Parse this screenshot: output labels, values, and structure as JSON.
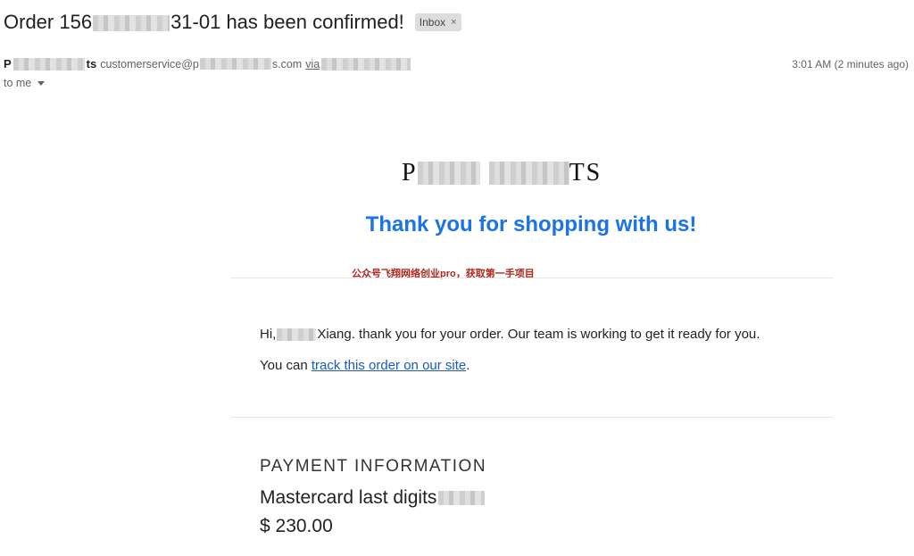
{
  "subject": {
    "prefix": "Order 156",
    "suffix": "31-01 has been confirmed!",
    "label": "Inbox",
    "label_close": "×"
  },
  "sender": {
    "name_start": "P",
    "name_end": "ts",
    "email_start": "customerservice@p",
    "email_end": "s.com",
    "via": "via",
    "timestamp": "3:01 AM (2 minutes ago)",
    "to": "to me"
  },
  "body": {
    "logo_start": "P",
    "logo_end": "TS",
    "thanks": "Thank you for shopping with us!",
    "watermark": "公众号飞翔网络创业pro，获取第一手项目",
    "greeting_start": "Hi,",
    "greeting_end": "Xiang. thank you for your order. Our team is working to get it ready for you.",
    "track_prefix": "You can ",
    "track_link": "track this order on our site",
    "track_suffix": ".",
    "payment_heading": "PAYMENT INFORMATION",
    "card_text": "Mastercard last digits",
    "amount": "$ 230.00"
  },
  "colors": {
    "accent": "#1a73e8",
    "link": "#1a5bbd",
    "watermark": "#b3261e",
    "chip_bg": "#dddddd"
  },
  "icons": {
    "recipients_toggle": "caret-down-icon",
    "label_remove": "close-icon"
  }
}
